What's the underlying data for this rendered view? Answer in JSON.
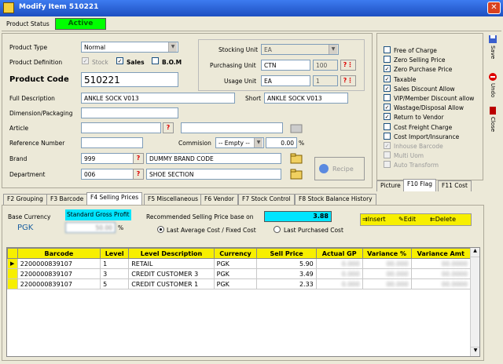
{
  "window": {
    "title": "Modify Item 510221"
  },
  "status": {
    "label": "Product Status",
    "value": "Active"
  },
  "left": {
    "product_type_label": "Product Type",
    "product_type_value": "Normal",
    "product_def_label": "Product Definition",
    "def_stock": "Stock",
    "def_sales": "Sales",
    "def_bom": "B.O.M",
    "product_code_label": "Product Code",
    "product_code_value": "510221",
    "full_desc_label": "Full Description",
    "full_desc_value": "ANKLE SOCK V013",
    "short_label": "Short",
    "short_value": "ANKLE SOCK V013",
    "dimension_label": "Dimension/Packaging",
    "article_label": "Article",
    "ref_label": "Reference Number",
    "commision_label": "Commision",
    "commision_value": "-- Empty --",
    "commision_pct": "0.00",
    "pct_sign": "%",
    "brand_label": "Brand",
    "brand_code": "999",
    "brand_name": "DUMMY BRAND CODE",
    "dept_label": "Department",
    "dept_code": "006",
    "dept_name": "SHOE SECTION",
    "recipe_label": "Recipe"
  },
  "units": {
    "stocking_label": "Stocking Unit",
    "stocking_value": "EA",
    "purchasing_label": "Purchasing Unit",
    "purchasing_value": "CTN",
    "purchasing_qty": "100",
    "usage_label": "Usage Unit",
    "usage_value": "EA",
    "usage_qty": "1"
  },
  "flags": [
    {
      "label": "Free of Charge",
      "checked": false,
      "disabled": false
    },
    {
      "label": "Zero Selling Price",
      "checked": false,
      "disabled": false
    },
    {
      "label": "Zero Purchase Price",
      "checked": true,
      "disabled": false
    },
    {
      "label": "Taxable",
      "checked": true,
      "disabled": false
    },
    {
      "label": "Sales Discount Allow",
      "checked": true,
      "disabled": false
    },
    {
      "label": "VIP/Member Discount allow",
      "checked": false,
      "disabled": false
    },
    {
      "label": "Wastage/Disposal Allow",
      "checked": true,
      "disabled": false
    },
    {
      "label": "Return to Vendor",
      "checked": true,
      "disabled": false
    },
    {
      "label": "Cost Freight Charge",
      "checked": false,
      "disabled": false
    },
    {
      "label": "Cost Import/Insurance",
      "checked": false,
      "disabled": false
    },
    {
      "label": "Inhouse Barcode",
      "checked": true,
      "disabled": true
    },
    {
      "label": "Multi Uom",
      "checked": false,
      "disabled": true
    },
    {
      "label": "Auto Transform",
      "checked": false,
      "disabled": true
    }
  ],
  "right_tabs": [
    "Picture",
    "F10 Flag",
    "F11 Cost"
  ],
  "side_buttons": [
    "Save",
    "Undo",
    "Close"
  ],
  "tabs": [
    "F2 Grouping",
    "F3 Barcode",
    "F4 Selling Prices",
    "F5 Miscellaneous",
    "F6 Vendor",
    "F7 Stock Control",
    "F8 Stock Balance History"
  ],
  "pricing": {
    "base_currency_label": "Base Currency",
    "base_currency_value": "PGK",
    "sgp_label": "Standard Gross Profit",
    "sgp_value": "50.00",
    "sgp_pct": "%",
    "rec_label": "Recommended Selling Price base on",
    "rec_value": "3.88",
    "opt1": "Last Average Cost / Fixed Cost",
    "opt2": "Last Purchased Cost",
    "insert": "Insert",
    "edit": "Edit",
    "delete": "Delete"
  },
  "grid": {
    "headers": [
      "Barcode",
      "Level",
      "Level Description",
      "Currency",
      "Sell Price",
      "Actual GP",
      "Variance %",
      "Variance Amt"
    ],
    "rows": [
      [
        "2200000839107",
        "1",
        "RETAIL",
        "PGK",
        "5.90",
        "0.000",
        "00.000",
        "00.0000"
      ],
      [
        "2200000839107",
        "3",
        "CREDIT CUSTOMER 3",
        "PGK",
        "3.49",
        "0.000",
        "00.000",
        "00.0000"
      ],
      [
        "2200000839107",
        "5",
        "CREDIT CUSTOMER 1",
        "PGK",
        "2.33",
        "0.000",
        "00.000",
        "00.0000"
      ]
    ]
  }
}
